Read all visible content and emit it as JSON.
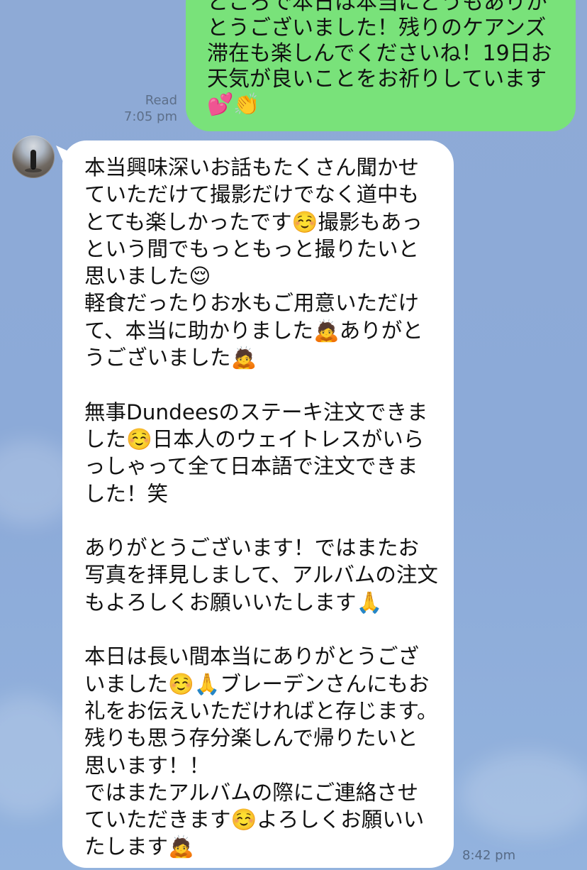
{
  "sent_message": {
    "text": "ところで本日は本当にどうもありがとうございました！残りのケアンズ滞在も楽しんでくださいね！19日お天気が良いことをお祈りしています💕👏",
    "read_label": "Read",
    "time": "7:05 pm"
  },
  "received_message": {
    "text": "本当興味深いお話もたくさん聞かせていただけて撮影だけでなく道中もとても楽しかったです☺️撮影もあっという間でもっともっと撮りたいと思いました😌\n軽食だったりお水もご用意いただけて、本当に助かりました🙇ありがとうございました🙇\n\n無事Dundeesのステーキ注文できました☺️日本人のウェイトレスがいらっしゃって全て日本語で注文できました！笑\n\nありがとうございます！ではまたお写真を拝見しまして、アルバムの注文もよろしくお願いいたします🙏\n\n本日は長い間本当にありがとうございました☺️🙏ブレーデンさんにもお礼をお伝えいただければと存じます。残りも思う存分楽しんで帰りたいと思います！！\nではまたアルバムの際にご連絡させていただきます☺️よろしくお願いいたします🙇",
    "time": "8:42 pm"
  },
  "colors": {
    "background": "#8eaad6",
    "sent_bubble": "#79e27a",
    "received_bubble": "#ffffff",
    "meta_text": "#5d6f89"
  }
}
